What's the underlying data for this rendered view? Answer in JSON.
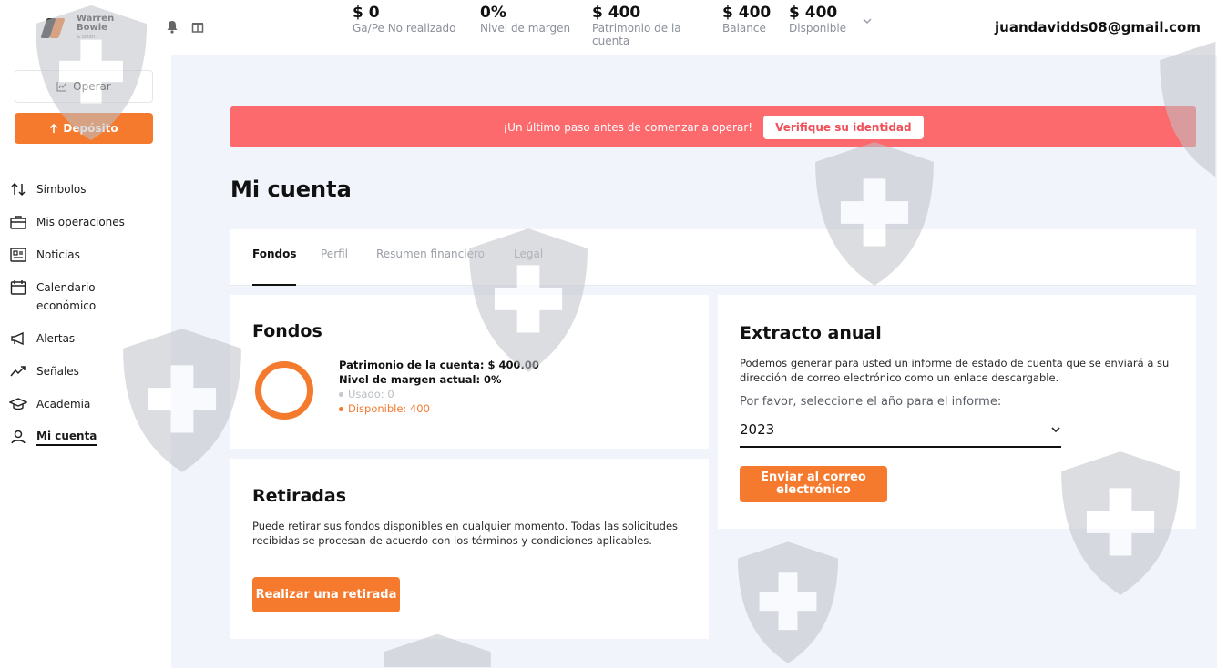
{
  "brand": {
    "line1": "Warren",
    "line2": "Bowie",
    "line3": "& Smith"
  },
  "header": {
    "stats": [
      {
        "value": "$ 0",
        "label": "Ga/Pe No realizado"
      },
      {
        "value": "0%",
        "label": "Nivel de margen"
      },
      {
        "value": "$ 400",
        "label": "Patrimonio de la cuenta"
      },
      {
        "value": "$ 400",
        "label": "Balance"
      },
      {
        "value": "$ 400",
        "label": "Disponible"
      }
    ],
    "email": "juandavidds08@gmail.com"
  },
  "sidebar": {
    "operar": "Operar",
    "deposito": "Depósito",
    "items": [
      {
        "label": "Símbolos",
        "icon": "arrows-updown-icon"
      },
      {
        "label": "Mis operaciones",
        "icon": "briefcase-icon"
      },
      {
        "label": "Noticias",
        "icon": "news-icon"
      },
      {
        "label": "Calendario económico",
        "icon": "calendar-icon"
      },
      {
        "label": "Alertas",
        "icon": "megaphone-icon"
      },
      {
        "label": "Señales",
        "icon": "signal-icon"
      },
      {
        "label": "Academia",
        "icon": "academy-icon"
      },
      {
        "label": "Mi cuenta",
        "icon": "user-icon"
      }
    ]
  },
  "banner": {
    "text": "¡Un último paso antes de comenzar a operar!",
    "button": "Verifique su identidad"
  },
  "page": {
    "title": "Mi cuenta",
    "tabs": [
      "Fondos",
      "Perfil",
      "Resumen financiero",
      "Legal"
    ]
  },
  "fondos": {
    "title": "Fondos",
    "patrimonio": "Patrimonio de la cuenta: $ 400.00",
    "margen": "Nivel de margen actual: 0%",
    "usado": "Usado: 0",
    "disponible": "Disponible: 400"
  },
  "retiradas": {
    "title": "Retiradas",
    "text": "Puede retirar sus fondos disponibles en cualquier momento. Todas las solicitudes recibidas se procesan de acuerdo con los términos y condiciones aplicables.",
    "button": "Realizar una retirada"
  },
  "extracto": {
    "title": "Extracto anual",
    "text": "Podemos generar para usted un informe de estado de cuenta que se enviará a su dirección de correo electrónico como un enlace descargable.",
    "select_label": "Por favor, seleccione el año para el informe:",
    "year": "2023",
    "button": "Enviar al correo electrónico"
  },
  "colors": {
    "accent": "#f57a2e",
    "banner": "#fc6a6d",
    "bg": "#f1f4fb"
  }
}
